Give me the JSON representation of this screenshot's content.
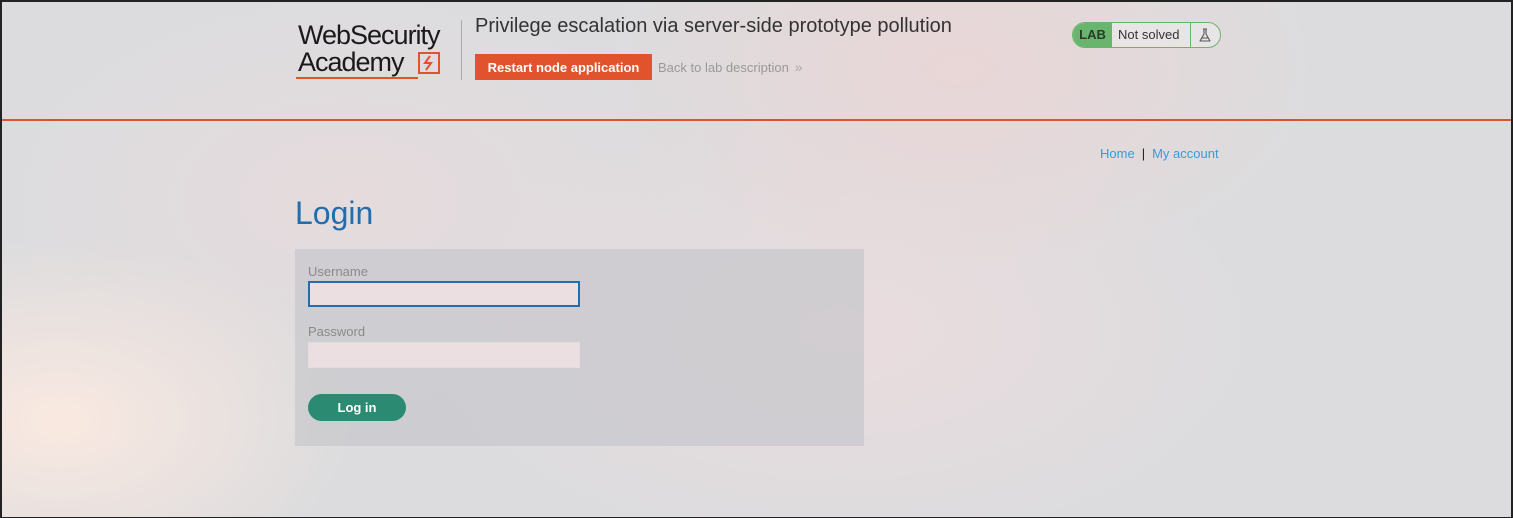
{
  "header": {
    "logo_line1": "WebSecurity",
    "logo_line2": "Academy",
    "lab_title": "Privilege escalation via server-side prototype pollution",
    "restart_label": "Restart node application",
    "back_label": "Back to lab description",
    "back_chevron": "»",
    "status": {
      "badge": "LAB",
      "text": "Not solved",
      "icon": "flask-icon"
    }
  },
  "nav": {
    "home": "Home",
    "separator": "|",
    "account": "My account"
  },
  "login": {
    "title": "Login",
    "username_label": "Username",
    "username_value": "",
    "password_label": "Password",
    "password_value": "",
    "submit_label": "Log in"
  },
  "colors": {
    "accent": "#e0532c",
    "title_blue": "#1e6eb0",
    "link_blue": "#3a9bd6",
    "button_green": "#2b8a72",
    "status_green": "#6ab56e"
  }
}
